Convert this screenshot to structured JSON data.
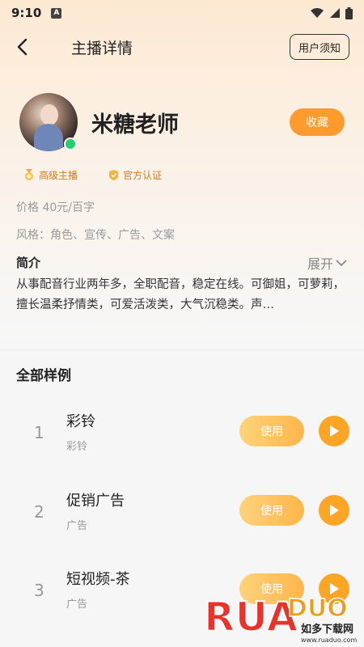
{
  "status_bar": {
    "time": "9:10",
    "notif_glyph": "A"
  },
  "nav": {
    "title": "主播详情",
    "notice_label": "用户须知"
  },
  "anchor": {
    "name": "米糖老师",
    "favorite_label": "收藏",
    "badges": [
      "高级主播",
      "官方认证"
    ],
    "price": "价格 40元/百字",
    "style": "风格：角色、宣传、广告、文案",
    "intro_label": "简介",
    "expand_label": "展开",
    "intro_text": "从事配音行业两年多，全职配音，稳定在线。可御姐，可萝莉，擅长温柔抒情类，可爱活泼类，大气沉稳类。声…"
  },
  "samples": {
    "title": "全部样例",
    "use_label": "使用",
    "items": [
      {
        "index": "1",
        "name": "彩铃",
        "category": "彩铃"
      },
      {
        "index": "2",
        "name": "促销广告",
        "category": "广告"
      },
      {
        "index": "3",
        "name": "短视频-茶",
        "category": "广告"
      }
    ]
  },
  "watermark": {
    "brand": "RUANDUO",
    "cn": "如多下载网",
    "url": "www.ruaduo.com"
  },
  "colors": {
    "accent": "#ff9a2e",
    "online": "#22d06b",
    "badge_text": "#d97a1a"
  },
  "icons": [
    "back-arrow-icon",
    "wifi-icon",
    "signal-icon",
    "battery-icon",
    "medal-icon",
    "shield-icon",
    "chevron-down-icon",
    "play-icon"
  ]
}
